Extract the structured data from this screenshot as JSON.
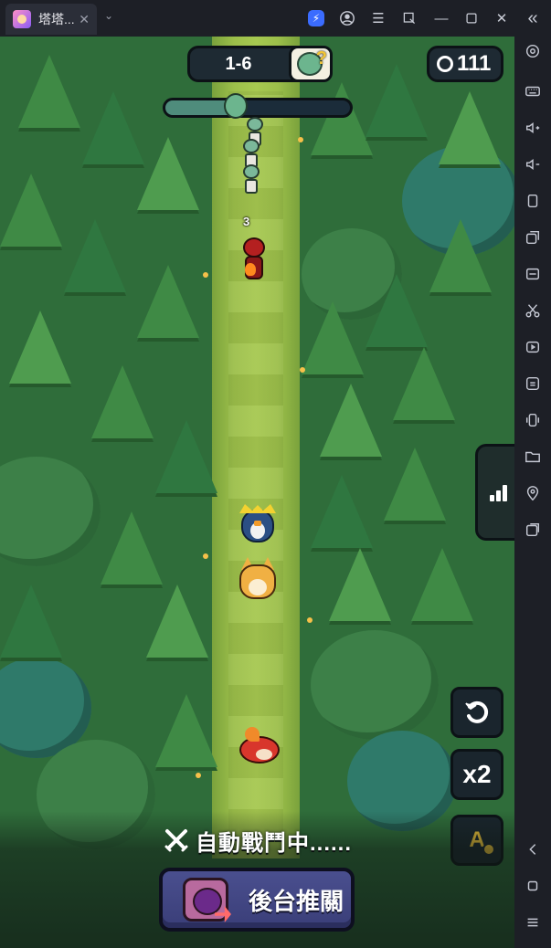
{
  "window": {
    "tab_title": "塔塔...",
    "tab_close": "✕",
    "dropdown": "⌄"
  },
  "hud": {
    "stage": "1-6",
    "boss_hint": "?",
    "timer": "111",
    "wave_progress": 0.38
  },
  "battle": {
    "hit_number": "3"
  },
  "controls": {
    "speed_label": "x2",
    "auto_label": "A"
  },
  "bottom": {
    "auto_status": "自動戰鬥中......",
    "offline_button": "後台推關"
  },
  "colors": {
    "accent": "#3b6cff",
    "button_purple": "#4a4f8f",
    "auto_gold": "#f3c63a"
  }
}
